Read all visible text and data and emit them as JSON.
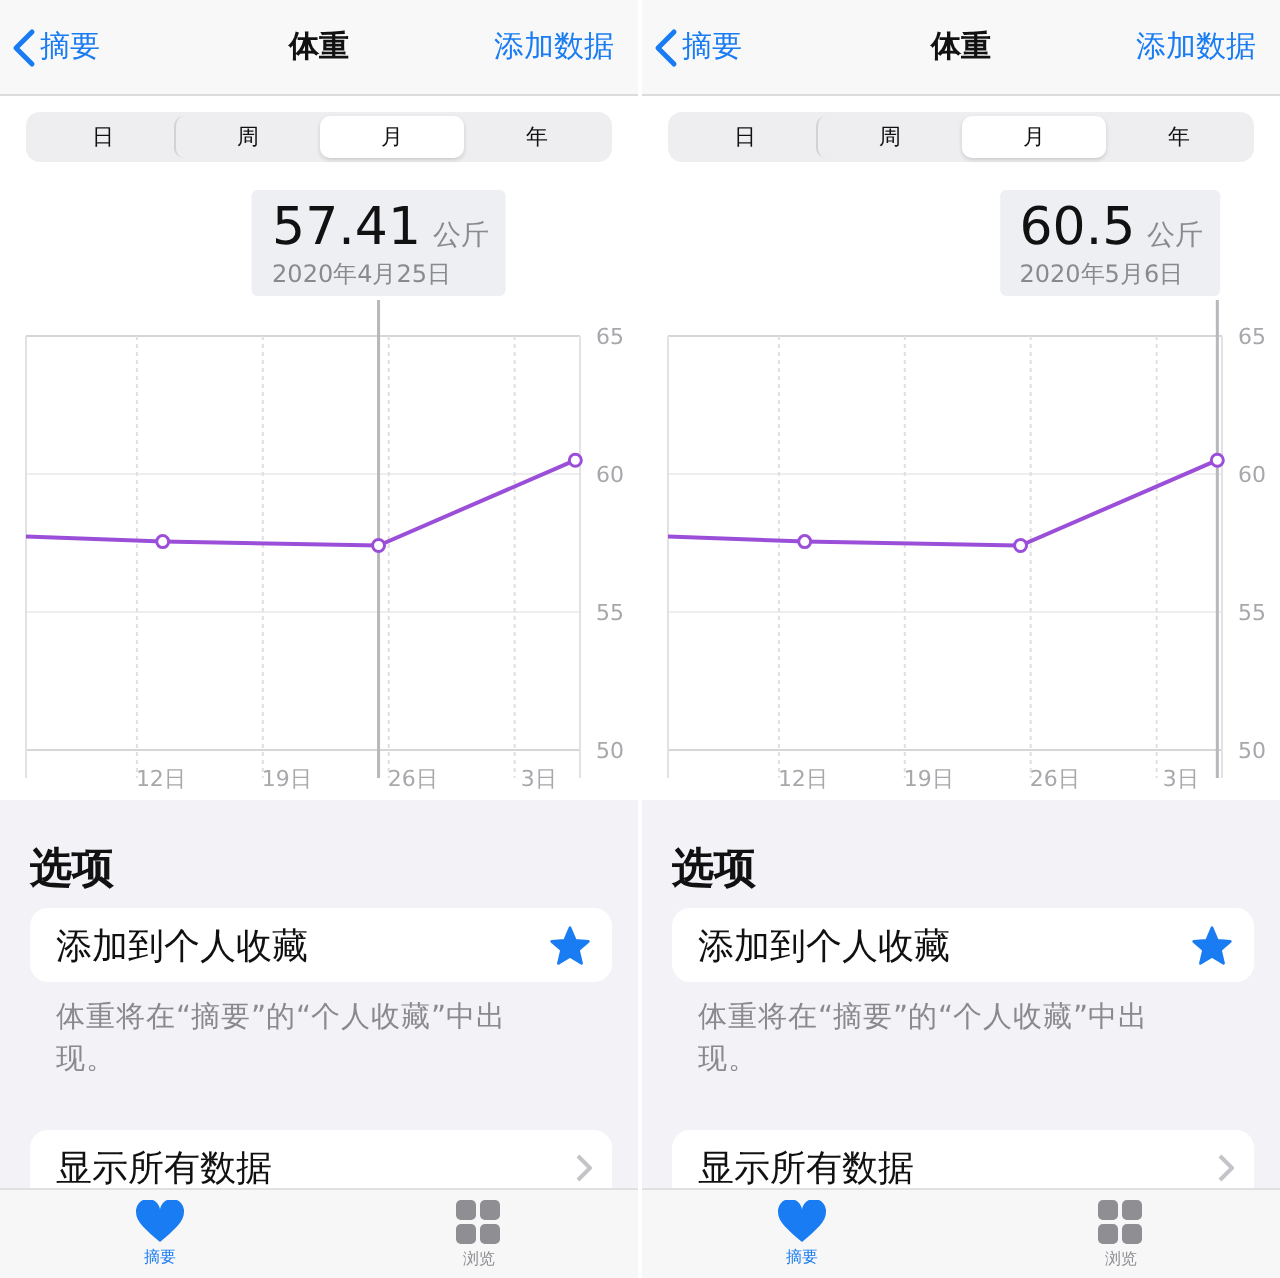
{
  "panels": [
    {
      "nav": {
        "back": "摘要",
        "title": "体重",
        "action": "添加数据"
      },
      "segments": [
        {
          "label": "日",
          "selected": false
        },
        {
          "label": "周",
          "selected": false
        },
        {
          "label": "月",
          "selected": true
        },
        {
          "label": "年",
          "selected": false
        }
      ],
      "callout": {
        "value": "57.41",
        "unit": "公斤",
        "date": "2020年4月25日"
      },
      "chart_data": {
        "type": "line",
        "x": [
          4.5,
          12.1,
          24.1,
          35.04
        ],
        "series": [
          {
            "color": "#9b4fd9",
            "marker": "circle",
            "values": [
              57.74,
              57.55,
              57.41,
              60.5
            ]
          }
        ],
        "xlim": [
          4.5,
          35.3
        ],
        "ylim": [
          50,
          65
        ],
        "xticks": [
          {
            "value": 12,
            "label": "12日"
          },
          {
            "value": 19,
            "label": "19日"
          },
          {
            "value": 26,
            "label": "26日"
          }
        ],
        "yticks": [
          {
            "value": 50,
            "label": "50"
          },
          {
            "value": 55,
            "label": "55"
          },
          {
            "value": 60,
            "label": "60"
          },
          {
            "value": 65,
            "label": "65"
          }
        ],
        "ref_lines": [
          {
            "axis": "x",
            "value": 24.1
          }
        ]
      },
      "x_extra_labels": [
        "3日"
      ],
      "options": {
        "heading": "选项",
        "favorite": {
          "label": "添加到个人收藏",
          "starred": true
        },
        "note": "体重将在“摘要”的“个人收藏”中出现。",
        "show_all": "显示所有数据"
      },
      "tab_bar": [
        {
          "kind": "heart",
          "label": "摘要",
          "selected": true
        },
        {
          "kind": "grid",
          "label": "浏览",
          "selected": false
        }
      ]
    },
    {
      "nav": {
        "back": "摘要",
        "title": "体重",
        "action": "添加数据"
      },
      "segments": [
        {
          "label": "日",
          "selected": false
        },
        {
          "label": "周",
          "selected": false
        },
        {
          "label": "月",
          "selected": true
        },
        {
          "label": "年",
          "selected": false
        }
      ],
      "callout": {
        "value": "60.5",
        "unit": "公斤",
        "date": "2020年5月6日"
      },
      "chart_data": {
        "type": "line",
        "x": [
          4.5,
          12.1,
          24.1,
          35.04
        ],
        "series": [
          {
            "color": "#9b4fd9",
            "marker": "circle",
            "values": [
              57.74,
              57.55,
              57.41,
              60.5
            ]
          }
        ],
        "xlim": [
          4.5,
          35.3
        ],
        "ylim": [
          50,
          65
        ],
        "xticks": [
          {
            "value": 12,
            "label": "12日"
          },
          {
            "value": 19,
            "label": "19日"
          },
          {
            "value": 26,
            "label": "26日"
          }
        ],
        "yticks": [
          {
            "value": 50,
            "label": "50"
          },
          {
            "value": 55,
            "label": "55"
          },
          {
            "value": 60,
            "label": "60"
          },
          {
            "value": 65,
            "label": "65"
          }
        ],
        "ref_lines": [
          {
            "axis": "x",
            "value": 35.04
          }
        ]
      },
      "x_extra_labels": [
        "3日"
      ],
      "options": {
        "heading": "选项",
        "favorite": {
          "label": "添加到个人收藏",
          "starred": true
        },
        "note": "体重将在“摘要”的“个人收藏”中出现。",
        "show_all": "显示所有数据"
      },
      "tab_bar": [
        {
          "kind": "heart",
          "label": "摘要",
          "selected": true
        },
        {
          "kind": "grid",
          "label": "浏览",
          "selected": false
        }
      ]
    }
  ]
}
